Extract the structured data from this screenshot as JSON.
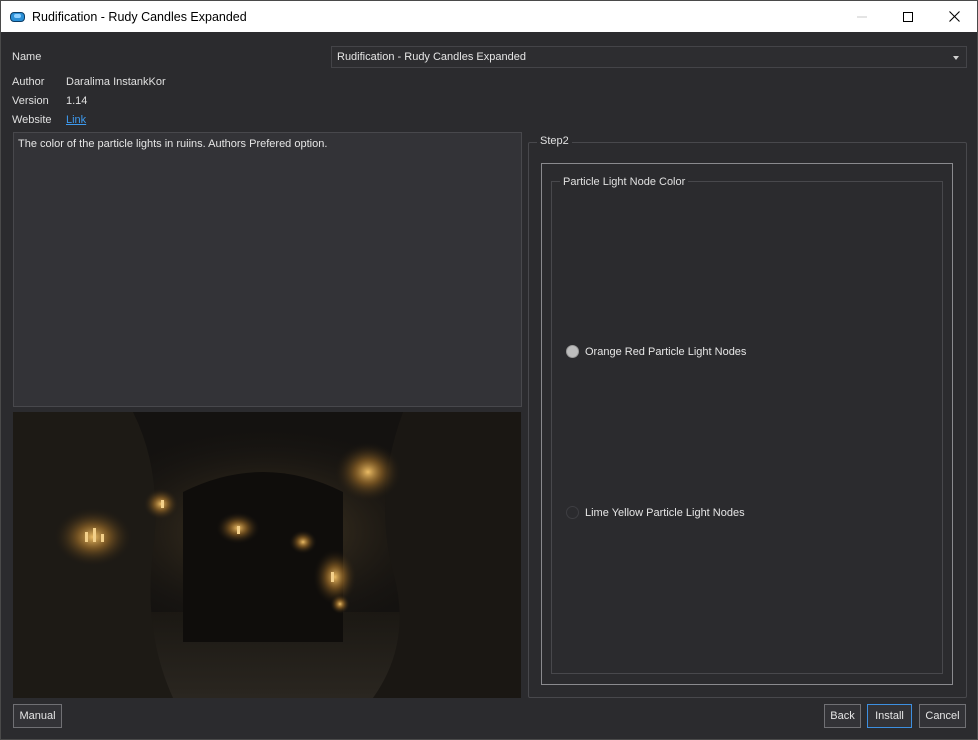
{
  "window": {
    "title": "Rudification - Rudy Candles Expanded",
    "controls": {
      "minimize": "minimize-icon",
      "maximize": "maximize-icon",
      "close": "close-icon"
    }
  },
  "fields": {
    "name_label": "Name",
    "name_value": "Rudification - Rudy Candles Expanded",
    "author_label": "Author",
    "author_value": "Daralima InstankKor",
    "version_label": "Version",
    "version_value": "1.14",
    "website_label": "Website",
    "website_link": "Link"
  },
  "description": "The color of the particle lights in ruiins. Authors Prefered option.",
  "step": {
    "title": "Step2",
    "group_title": "Particle Light Node Color",
    "options": [
      {
        "label": "Orange Red Particle Light Nodes",
        "selected": true
      },
      {
        "label": "Lime Yellow Particle Light Nodes",
        "selected": false
      }
    ]
  },
  "buttons": {
    "manual": "Manual",
    "back": "Back",
    "install": "Install",
    "cancel": "Cancel"
  },
  "colors": {
    "background": "#2b2b2e",
    "accent": "#3d9bf0",
    "titlebar": "#ffffff"
  }
}
